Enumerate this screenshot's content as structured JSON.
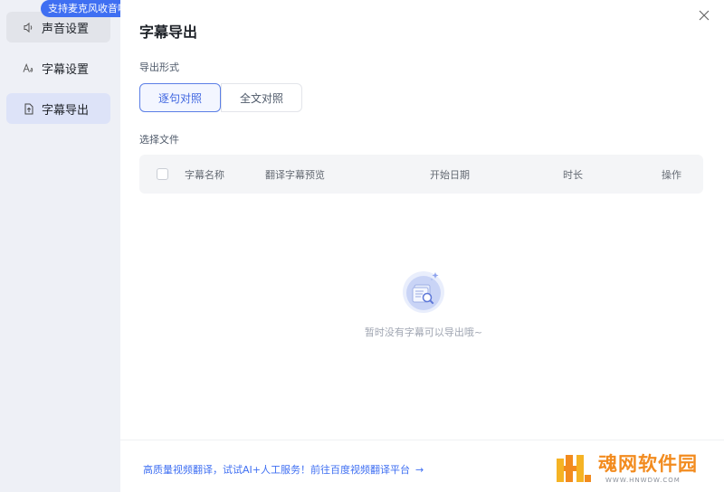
{
  "sidebar": {
    "badge": "支持麦克风收音啦~",
    "items": [
      {
        "label": "声音设置",
        "icon": "speaker-icon"
      },
      {
        "label": "字幕设置",
        "icon": "text-style-icon"
      },
      {
        "label": "字幕导出",
        "icon": "export-file-icon"
      }
    ],
    "active_index": 2
  },
  "main": {
    "title": "字幕导出",
    "format_label": "导出形式",
    "formats": [
      {
        "label": "逐句对照",
        "selected": true
      },
      {
        "label": "全文对照",
        "selected": false
      }
    ],
    "file_label": "选择文件",
    "table": {
      "columns": [
        "字幕名称",
        "翻译字幕预览",
        "开始日期",
        "时长",
        "操作"
      ]
    },
    "empty_text": "暂时没有字幕可以导出哦~"
  },
  "footer": {
    "link_text": "高质量视频翻译，试试AI+人工服务！前往百度视频翻译平台",
    "arrow": "→"
  },
  "watermark": {
    "title": "魂网软件园",
    "subtitle": "WWW.HNWDW.COM"
  },
  "colors": {
    "accent": "#3f6ff2",
    "sidebar_bg": "#eef0f6",
    "watermark": "#f28b1e"
  }
}
